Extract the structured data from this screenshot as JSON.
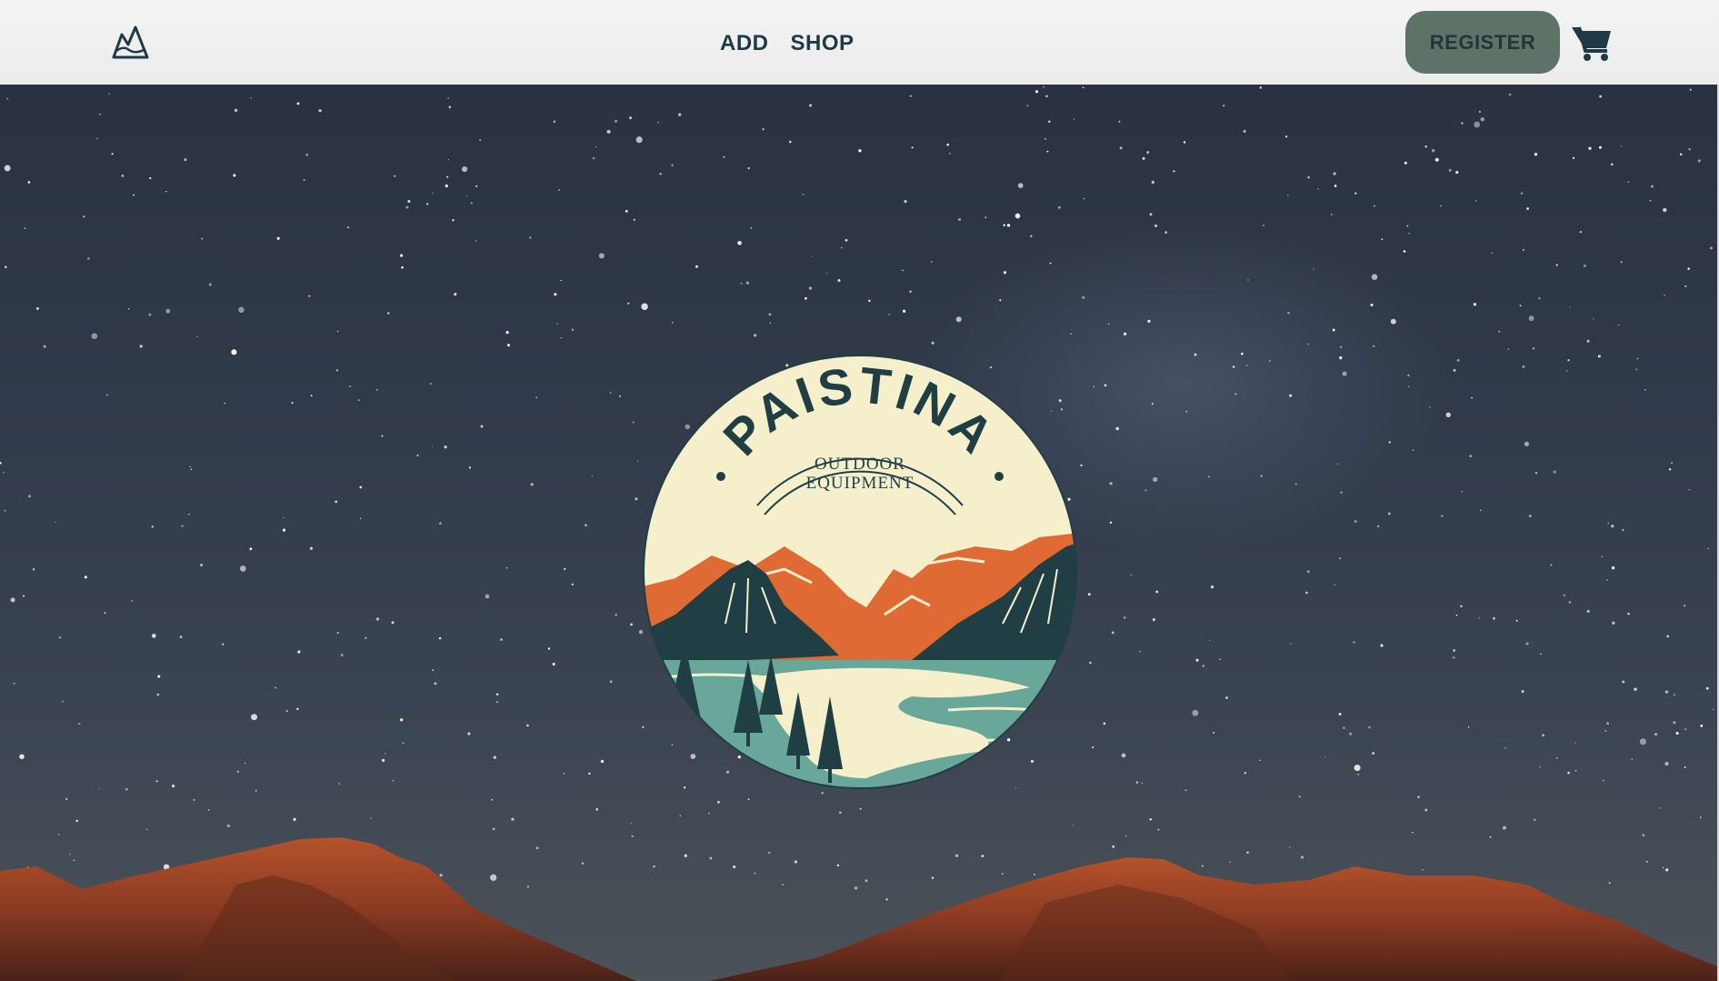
{
  "navbar": {
    "logo_icon": "mountain-logo-icon",
    "links": [
      {
        "label": "ADD"
      },
      {
        "label": "SHOP"
      }
    ],
    "register_label": "REGISTER",
    "cart_icon": "shopping-cart-icon"
  },
  "hero": {
    "background": "starry-night-sky-over-red-mountains",
    "badge": {
      "brand": "PAISTINA",
      "tagline_line1": "OUTDOOR",
      "tagline_line2": "EQUIPMENT"
    }
  },
  "colors": {
    "navbar_bg": "#eeeeee",
    "nav_text": "#1f3a44",
    "register_bg": "#5e7368",
    "badge_cream": "#f6efcc",
    "badge_orange": "#e06a33",
    "badge_teal": "#69a79a",
    "badge_dark": "#1f3f45"
  }
}
